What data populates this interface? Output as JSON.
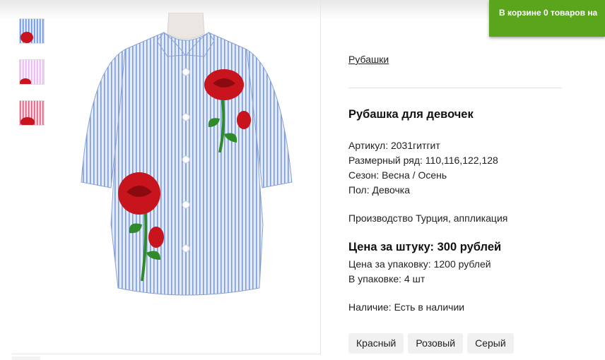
{
  "cart": {
    "prefix": "В корзине",
    "count": "0",
    "suffix": "товаров на"
  },
  "breadcrumb": "Рубашки",
  "product": {
    "title": "Рубашка для девочек",
    "specs": [
      "Артикул: 2031гитгит",
      "Размерный ряд: 110,116,122,128",
      "Сезон: Весна / Осень",
      "Пол: Девочка"
    ],
    "note": "Производство Турция, аппликация",
    "price": "Цена за штуку: 300 рублей",
    "pack_price": "Цена за упаковку: 1200 рублей",
    "pack_size": "В упаковке: 4 шт",
    "availability": "Наличие: Есть в наличии"
  },
  "colors": [
    "Красный",
    "Розовый",
    "Серый"
  ],
  "thumbnails": [
    {
      "icon": "blue-striped-shirt-thumbnail",
      "stripe": "#6b8fcf",
      "base": "#dfe8f7"
    },
    {
      "icon": "pink-striped-shirt-thumbnail",
      "stripe": "#e2b8ea",
      "base": "#f8eef9"
    },
    {
      "icon": "red-striped-shirt-thumbnail",
      "stripe": "#d0607d",
      "base": "#f6dbe2"
    }
  ],
  "theme": {
    "cart_bg": "#5aa51c",
    "shirt_stripe": "#7d9bd6",
    "rose": "#c8141c",
    "leaf": "#2f8a2a"
  }
}
